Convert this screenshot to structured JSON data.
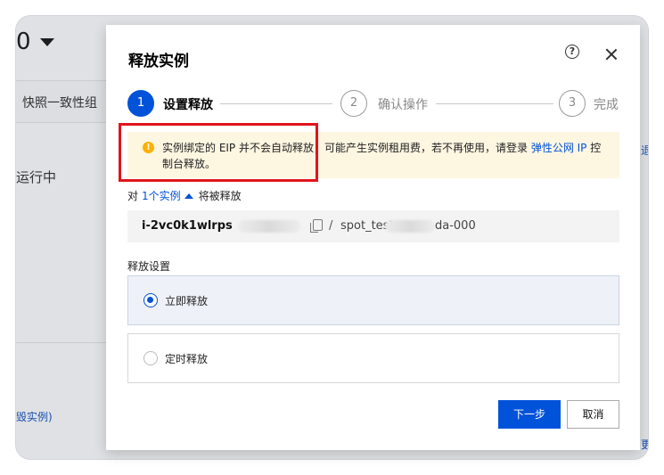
{
  "background": {
    "dropdown_value": "0",
    "tab_label": "快照一致性组",
    "status_text": "运行中",
    "link_text": "毁实例)",
    "right_edge_1": "退",
    "right_edge_2": "更"
  },
  "modal": {
    "title": "释放实例",
    "help_symbol": "?",
    "steps": [
      {
        "number": "1",
        "label": "设置释放"
      },
      {
        "number": "2",
        "label": "确认操作"
      },
      {
        "number": "3",
        "label": "完成"
      }
    ],
    "alert": {
      "icon": "!",
      "text_before": "实例绑定的 EIP 并不会自动释放，可能产生实例租用费，若不再使用，请登录 ",
      "link": "弹性公网 IP",
      "text_after": " 控制台释放。"
    },
    "count": {
      "prefix": "对",
      "link": "1个实例",
      "suffix": "将被释放"
    },
    "instance": {
      "id": "i-2vc0k1wlrps",
      "separator": "/",
      "name_prefix": "spot_test-c",
      "name_suffix": "da-000"
    },
    "section_label": "释放设置",
    "options": [
      {
        "label": "立即释放",
        "selected": true
      },
      {
        "label": "定时释放",
        "selected": false
      }
    ],
    "buttons": {
      "next": "下一步",
      "cancel": "取消"
    }
  },
  "colors": {
    "primary": "#0052d9",
    "alert_bg": "#fdf6e1",
    "warning_icon": "#ffb000",
    "highlight": "#e0141c"
  }
}
